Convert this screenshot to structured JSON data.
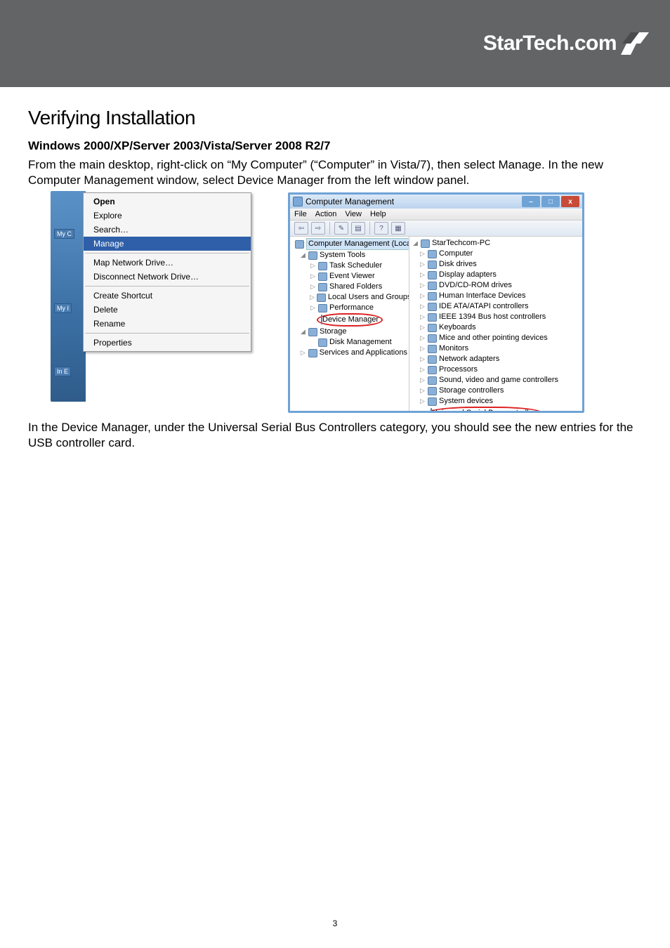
{
  "logo_text": "StarTech.com",
  "section_title": "Verifying Installation",
  "subhead": "Windows 2000/XP/Server 2003/Vista/Server 2008 R2/7",
  "intro": "From the main desktop, right-click on “My Computer” (“Computer” in Vista/7), then select Manage. In the new Computer Management window, select Device Manager from the left window panel.",
  "after_text": "In the Device Manager, under the Universal Serial Bus Controllers category, you should see the new entries for the USB controller card.",
  "page_number": "3",
  "context_menu": {
    "desktop_icons": [
      "My C",
      "My I",
      "In\nE"
    ],
    "groups": [
      [
        "Open",
        "Explore",
        "Search…",
        "Manage"
      ],
      [
        "Map Network Drive…",
        "Disconnect Network Drive…"
      ],
      [
        "Create Shortcut",
        "Delete",
        "Rename"
      ],
      [
        "Properties"
      ]
    ],
    "bold_item": "Open",
    "highlighted_item": "Manage"
  },
  "cm_window": {
    "title": "Computer Management",
    "menus": [
      "File",
      "Action",
      "View",
      "Help"
    ],
    "toolbar": [
      "⇦",
      "⇨",
      "sep",
      "✎",
      "▤",
      "sep",
      "?",
      "▦"
    ],
    "left_tree": [
      {
        "lvl": 0,
        "exp": "",
        "sel": true,
        "label": "Computer Management (Local"
      },
      {
        "lvl": 1,
        "exp": "◢",
        "label": "System Tools"
      },
      {
        "lvl": 2,
        "exp": "▷",
        "label": "Task Scheduler"
      },
      {
        "lvl": 2,
        "exp": "▷",
        "label": "Event Viewer"
      },
      {
        "lvl": 2,
        "exp": "▷",
        "label": "Shared Folders"
      },
      {
        "lvl": 2,
        "exp": "▷",
        "label": "Local Users and Groups"
      },
      {
        "lvl": 2,
        "exp": "▷",
        "label": "Performance"
      },
      {
        "lvl": 2,
        "exp": "",
        "ring": true,
        "label": "Device Manager"
      },
      {
        "lvl": 1,
        "exp": "◢",
        "label": "Storage"
      },
      {
        "lvl": 2,
        "exp": "",
        "label": "Disk Management"
      },
      {
        "lvl": 1,
        "exp": "▷",
        "label": "Services and Applications"
      }
    ],
    "right_tree": [
      {
        "lvl": 0,
        "exp": "◢",
        "label": "StarTechcom-PC"
      },
      {
        "lvl": 1,
        "exp": "▷",
        "label": "Computer"
      },
      {
        "lvl": 1,
        "exp": "▷",
        "label": "Disk drives"
      },
      {
        "lvl": 1,
        "exp": "▷",
        "label": "Display adapters"
      },
      {
        "lvl": 1,
        "exp": "▷",
        "label": "DVD/CD-ROM drives"
      },
      {
        "lvl": 1,
        "exp": "▷",
        "label": "Human Interface Devices"
      },
      {
        "lvl": 1,
        "exp": "▷",
        "label": "IDE ATA/ATAPI controllers"
      },
      {
        "lvl": 1,
        "exp": "▷",
        "label": "IEEE 1394 Bus host controllers"
      },
      {
        "lvl": 1,
        "exp": "▷",
        "label": "Keyboards"
      },
      {
        "lvl": 1,
        "exp": "▷",
        "label": "Mice and other pointing devices"
      },
      {
        "lvl": 1,
        "exp": "▷",
        "label": "Monitors"
      },
      {
        "lvl": 1,
        "exp": "▷",
        "label": "Network adapters"
      },
      {
        "lvl": 1,
        "exp": "▷",
        "label": "Processors"
      },
      {
        "lvl": 1,
        "exp": "▷",
        "label": "Sound, video and game controllers"
      },
      {
        "lvl": 1,
        "exp": "▷",
        "label": "Storage controllers"
      },
      {
        "lvl": 1,
        "exp": "▷",
        "label": "System devices"
      },
      {
        "lvl": 1,
        "exp": "▷",
        "ring": true,
        "label": "Universal Serial Bus controllers"
      }
    ]
  }
}
